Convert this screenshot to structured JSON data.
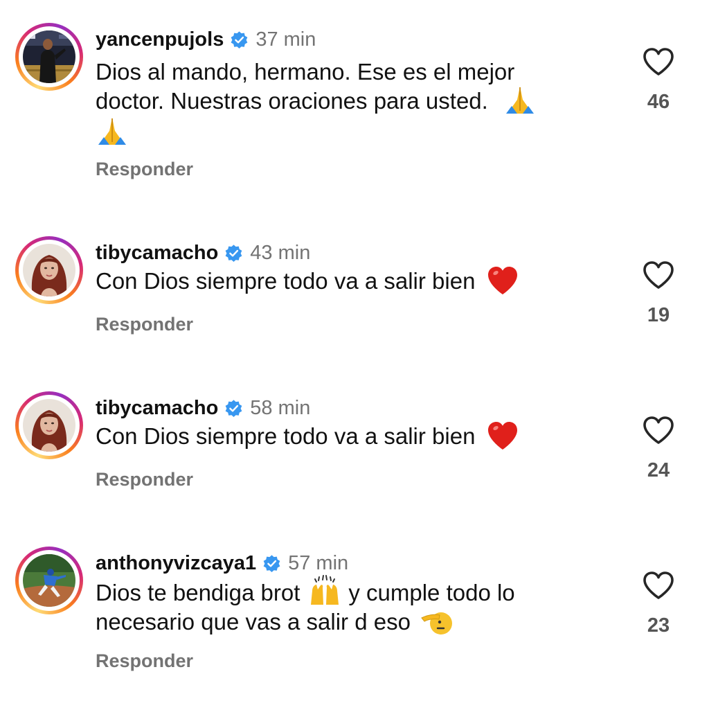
{
  "comments": [
    {
      "username": "yancenpujols",
      "time": "37 min",
      "text_line1": "Dios al mando, hermano. Ese es el mejor",
      "text_line2": "doctor. Nuestras oraciones para usted.",
      "emoji": [
        "folded-hands",
        "folded-hands"
      ],
      "reply_label": "Responder",
      "likes": "46"
    },
    {
      "username": "tibycamacho",
      "time": "43 min",
      "text": "Con Dios siempre todo va a salir bien",
      "emoji": [
        "red-heart"
      ],
      "reply_label": "Responder",
      "likes": "19"
    },
    {
      "username": "tibycamacho",
      "time": "58 min",
      "text": "Con Dios siempre todo va a salir bien",
      "emoji": [
        "red-heart"
      ],
      "reply_label": "Responder",
      "likes": "24"
    },
    {
      "username": "anthonyvizcaya1",
      "time": "57 min",
      "text_part1": "Dios te bendiga brot",
      "text_part2": "y cumple todo lo",
      "text_line2": "necesario que vas a salir d eso",
      "emoji": [
        "raising-hands",
        "saluting-face"
      ],
      "reply_label": "Responder",
      "likes": "23"
    }
  ],
  "colors": {
    "verified": "#3897f0",
    "secondary_text": "#737373",
    "ring": [
      "#feda75",
      "#fa7e1e",
      "#d62976",
      "#962fbf"
    ]
  },
  "icons": {
    "verified": "verified-badge-icon",
    "like": "heart-outline-icon"
  }
}
